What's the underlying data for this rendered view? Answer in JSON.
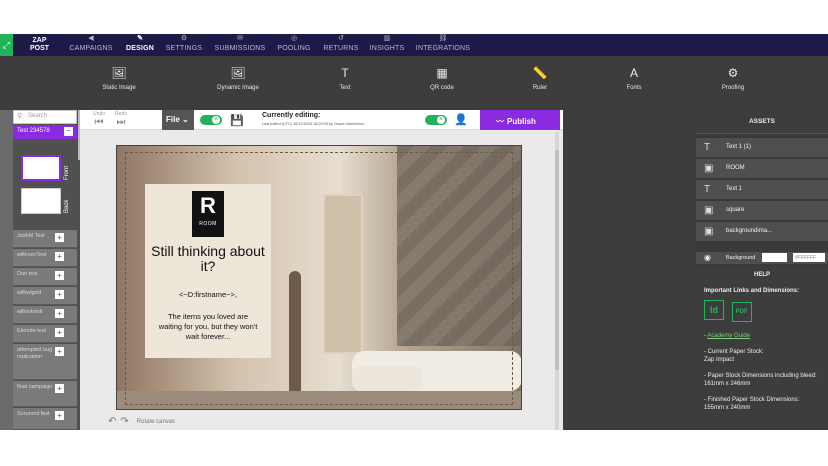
{
  "nav": {
    "logo_top": "ZAP",
    "logo_bottom": "POST",
    "items": [
      {
        "label": "CAMPAIGNS",
        "icon": "megaphone-icon"
      },
      {
        "label": "DESIGN",
        "icon": "design-icon"
      },
      {
        "label": "SETTINGS",
        "icon": "settings-icon"
      },
      {
        "label": "SUBMISSIONS",
        "icon": "submissions-icon"
      },
      {
        "label": "POOLING",
        "icon": "pooling-icon"
      },
      {
        "label": "RETURNS",
        "icon": "returns-icon"
      },
      {
        "label": "INSIGHTS",
        "icon": "insights-icon"
      },
      {
        "label": "INTEGRATIONS",
        "icon": "integrations-icon"
      }
    ],
    "active": "DESIGN"
  },
  "toolbar": {
    "tools": [
      {
        "label": "Static Image",
        "icon": "image-icon"
      },
      {
        "label": "Dynamic Image",
        "icon": "dynamic-image-icon"
      },
      {
        "label": "Text",
        "icon": "text-icon"
      },
      {
        "label": "QR code",
        "icon": "qr-code-icon"
      },
      {
        "label": "Ruler",
        "icon": "ruler-icon"
      },
      {
        "label": "Fonts",
        "icon": "font-icon"
      },
      {
        "label": "Proofing",
        "icon": "proofing-icon"
      }
    ]
  },
  "leftpanel": {
    "search_placeholder": "Search",
    "test_label": "Test 234578",
    "front_label": "Front",
    "back_label": "Back",
    "items": [
      "JoshM Test",
      "willcoecTest",
      "Dan test",
      "willwdgrtd",
      "willoobsolt",
      "Elenote test",
      "attempted bug replication",
      "final campaign",
      "Sorunont fest"
    ]
  },
  "editbar": {
    "undo_label": "Undo",
    "redo_label": "Redo",
    "file_label": "File",
    "currently_editing": "Currently editing:",
    "last_edited": "Last edited (UTC) 16/12/2024 18:29:03 by Grace Hutchinson",
    "publish_label": "Publish"
  },
  "design": {
    "logo_letter": "R",
    "logo_word": "ROOM",
    "headline": "Still thinking about it?",
    "firstname_tag": "<~D:firstname~>,",
    "body": "The items you loved are waiting for you, but they won't wait forever..."
  },
  "rotate_label": "Rotate canvas",
  "assets": {
    "header": "ASSETS",
    "items": [
      {
        "label": "Text 1 (1)",
        "icon": "text-icon"
      },
      {
        "label": "ROOM",
        "icon": "image-icon"
      },
      {
        "label": "Text 1",
        "icon": "text-icon"
      },
      {
        "label": "square",
        "icon": "image-icon"
      },
      {
        "label": "backgroundima...",
        "icon": "image-icon"
      }
    ],
    "background_label": "Background",
    "background_value": "#FFFFFF"
  },
  "help": {
    "title": "HELP",
    "subtitle": "Important Links and Dimensions:",
    "indesign_label": "Id",
    "pdf_label": "PDF",
    "academy_link": "Academy Guide",
    "paper_stock_label": "- Current Paper Stock:",
    "paper_stock_value": "Zap Impact",
    "bleed_label": "- Paper Stock Dimensions including bleed:",
    "bleed_value": "161mm x 246mm",
    "finished_label": "- Finished Paper Stock Dimensions:",
    "finished_value": "155mm x 240mm"
  },
  "colors": {
    "nav_bg": "#1d1a48",
    "accent": "#8a2be2",
    "green": "#22b25a",
    "toolbar_bg": "#3d3d3d"
  }
}
